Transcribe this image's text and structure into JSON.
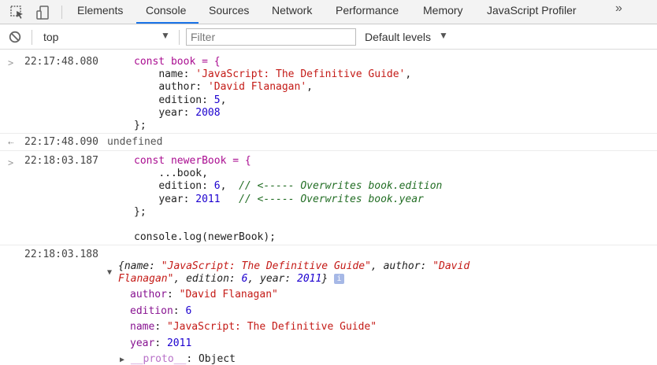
{
  "tabs": {
    "items": [
      {
        "label": "Elements"
      },
      {
        "label": "Console",
        "active": true
      },
      {
        "label": "Sources"
      },
      {
        "label": "Network"
      },
      {
        "label": "Performance"
      },
      {
        "label": "Memory"
      },
      {
        "label": "JavaScript Profiler"
      }
    ],
    "overflow": "»"
  },
  "toolbar": {
    "context": "top",
    "filter_placeholder": "Filter",
    "levels": "Default levels"
  },
  "console": {
    "e1": {
      "ts": "22:17:48.080",
      "l1": "const book = {",
      "name_key": "name",
      "name_val": "'JavaScript: The Definitive Guide'",
      "author_key": "author",
      "author_val": "'David Flanagan'",
      "edition_key": "edition",
      "edition_val": "5",
      "year_key": "year",
      "year_val": "2008",
      "close": "};"
    },
    "e2": {
      "ts": "22:17:48.090",
      "result": "undefined"
    },
    "e3": {
      "ts": "22:18:03.187",
      "l1": "const newerBook = {",
      "spread": "...book,",
      "edition_key": "edition",
      "edition_val": "6",
      "edition_cmt": "// <----- Overwrites book.edition",
      "year_key": "year",
      "year_val": "2011",
      "year_cmt": "// <----- Overwrites book.year",
      "close": "};",
      "log": "console.log(newerBook);"
    },
    "e4": {
      "ts": "22:18:03.188",
      "summary": {
        "open": "{",
        "name_key": "name",
        "name_val": "\"JavaScript: The Definitive Guide\"",
        "author_key": "author",
        "author_val": "\"David Flanagan\"",
        "edition_key": "edition",
        "edition_val": "6",
        "year_key": "year",
        "year_val": "2011",
        "close": "}"
      },
      "info": "i",
      "props": {
        "author_key": "author",
        "author_val": "\"David Flanagan\"",
        "edition_key": "edition",
        "edition_val": "6",
        "name_key": "name",
        "name_val": "\"JavaScript: The Definitive Guide\"",
        "year_key": "year",
        "year_val": "2011",
        "proto_key": "__proto__",
        "proto_val": "Object"
      }
    }
  }
}
